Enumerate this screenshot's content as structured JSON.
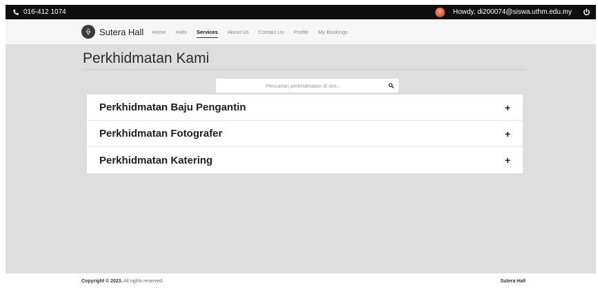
{
  "topbar": {
    "phone": "016-412 1074",
    "greeting": "Howdy, di200074@siswa.uthm.edu.my"
  },
  "navbar": {
    "brand": "Sutera Hall",
    "links": [
      "Home",
      "Halls",
      "Services",
      "About Us",
      "Contact Us",
      "Profile",
      "My Bookings"
    ],
    "active": "Services"
  },
  "main": {
    "title": "Perkhidmatan Kami",
    "search_placeholder": "Pencarian perkhidmatan di sini...",
    "services": [
      {
        "label": "Perkhidmatan Baju Pengantin",
        "toggle": "+"
      },
      {
        "label": "Perkhidmatan Fotografer",
        "toggle": "+"
      },
      {
        "label": "Perkhidmatan Katering",
        "toggle": "+"
      }
    ]
  },
  "footer": {
    "copyright_bold": "Copyright © 2023.",
    "copyright_rest": " All rights reserved.",
    "site_name": "Sutera Hall"
  },
  "colors": {
    "topbar_bg": "#0f0f0f",
    "page_bg": "#dedede",
    "card_bg": "#ffffff"
  },
  "icons": [
    "phone-icon",
    "avatar",
    "power-icon",
    "logo-icon",
    "search-icon"
  ]
}
